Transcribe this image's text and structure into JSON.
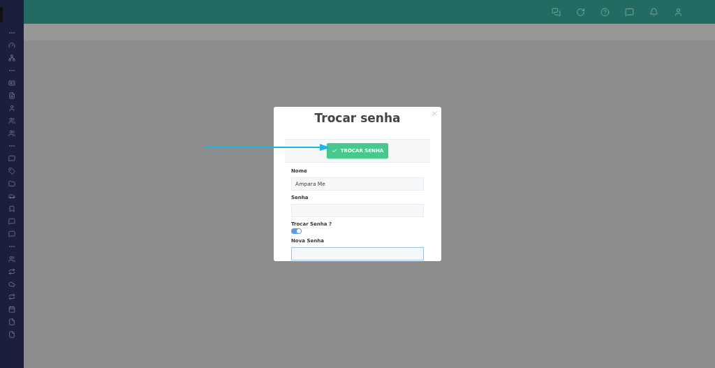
{
  "modal": {
    "title": "Trocar senha",
    "submit_button": {
      "label": "TROCAR SENHA"
    },
    "fields": [
      {
        "kind": "text",
        "label": "Nome",
        "value": "Ampara Me",
        "focused": false
      },
      {
        "kind": "text",
        "label": "Senha",
        "focused": false
      },
      {
        "kind": "toggle",
        "label": "Trocar Senha ?",
        "on": true
      },
      {
        "kind": "text",
        "label": "Nova Senha",
        "focused": true
      }
    ]
  }
}
